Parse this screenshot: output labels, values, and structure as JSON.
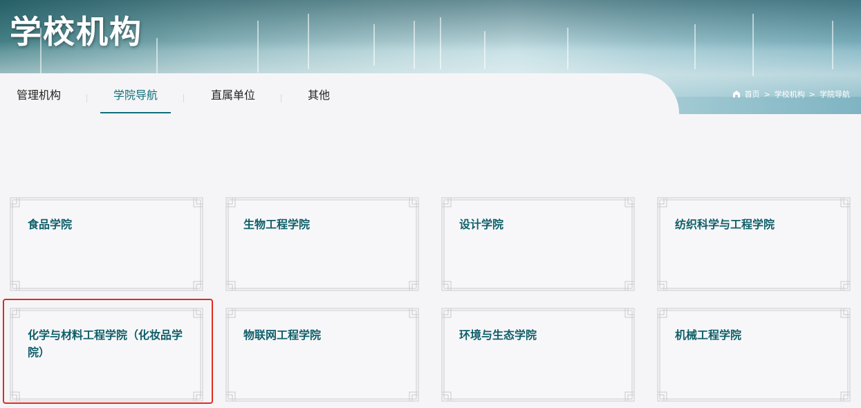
{
  "banner": {
    "title": "学校机构"
  },
  "tabs": [
    {
      "label": "管理机构",
      "active": false
    },
    {
      "label": "学院导航",
      "active": true
    },
    {
      "label": "直属单位",
      "active": false
    },
    {
      "label": "其他",
      "active": false
    }
  ],
  "breadcrumb": {
    "icon": "home-icon",
    "items": [
      "首页",
      "学校机构",
      "学院导航"
    ],
    "separator": ">"
  },
  "colleges": [
    "食品学院",
    "生物工程学院",
    "设计学院",
    "纺织科学与工程学院",
    "化学与材料工程学院（化妆品学院）",
    "物联网工程学院",
    "环境与生态学院",
    "机械工程学院"
  ],
  "colors": {
    "accent": "#0f6e7a",
    "card_title": "#0f5e68",
    "highlight": "#e02a20"
  }
}
